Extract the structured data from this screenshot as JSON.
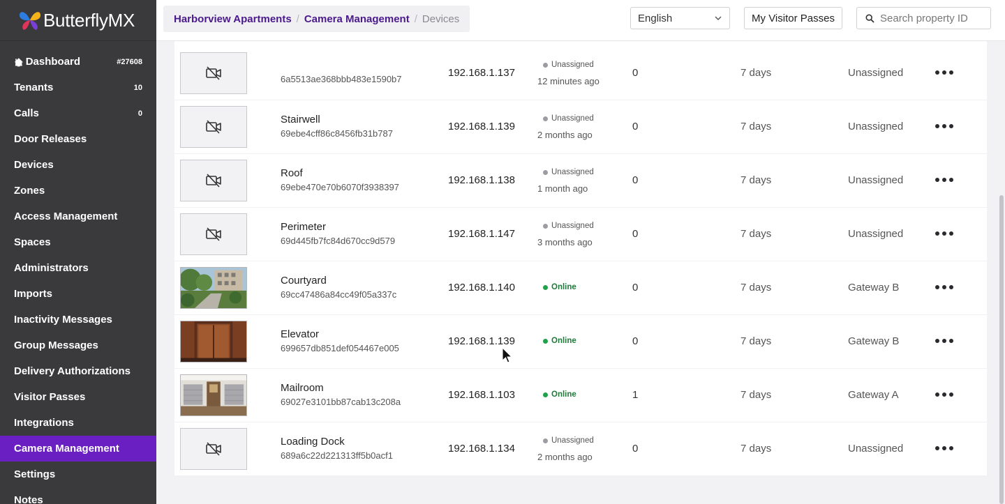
{
  "brand": {
    "name": "ButterflyMX"
  },
  "sidebar": {
    "items": [
      {
        "label": "Dashboard",
        "badge": "#27608",
        "active": false
      },
      {
        "label": "Tenants",
        "badge": "10",
        "active": false
      },
      {
        "label": "Calls",
        "badge": "0",
        "active": false
      },
      {
        "label": "Door Releases",
        "badge": "",
        "active": false
      },
      {
        "label": "Devices",
        "badge": "",
        "active": false
      },
      {
        "label": "Zones",
        "badge": "",
        "active": false
      },
      {
        "label": "Access Management",
        "badge": "",
        "active": false
      },
      {
        "label": "Spaces",
        "badge": "",
        "active": false
      },
      {
        "label": "Administrators",
        "badge": "",
        "active": false
      },
      {
        "label": "Imports",
        "badge": "",
        "active": false
      },
      {
        "label": "Inactivity Messages",
        "badge": "",
        "active": false
      },
      {
        "label": "Group Messages",
        "badge": "",
        "active": false
      },
      {
        "label": "Delivery Authorizations",
        "badge": "",
        "active": false
      },
      {
        "label": "Visitor Passes",
        "badge": "",
        "active": false
      },
      {
        "label": "Integrations",
        "badge": "",
        "active": false
      },
      {
        "label": "Camera Management",
        "badge": "",
        "active": true
      },
      {
        "label": "Settings",
        "badge": "",
        "active": false
      },
      {
        "label": "Notes",
        "badge": "",
        "active": false
      }
    ]
  },
  "breadcrumb": {
    "items": [
      "Harborview Apartments",
      "Camera Management"
    ],
    "current": "Devices",
    "separator": "/"
  },
  "header": {
    "language": "English",
    "visitor_passes_label": "My Visitor Passes",
    "search_placeholder": "Search property ID"
  },
  "cameras": [
    {
      "name": "",
      "id": "6a5513ae368bbb483e1590b7",
      "ip": "192.168.1.137",
      "status": "Unassigned",
      "online": false,
      "ago": "12 minutes ago",
      "count": "0",
      "retention": "7 days",
      "gateway": "Unassigned",
      "thumb": "none"
    },
    {
      "name": "Stairwell",
      "id": "69ebe4cff86c8456fb31b787",
      "ip": "192.168.1.139",
      "status": "Unassigned",
      "online": false,
      "ago": "2 months ago",
      "count": "0",
      "retention": "7 days",
      "gateway": "Unassigned",
      "thumb": "none"
    },
    {
      "name": "Roof",
      "id": "69ebe470e70b6070f3938397",
      "ip": "192.168.1.138",
      "status": "Unassigned",
      "online": false,
      "ago": "1 month ago",
      "count": "0",
      "retention": "7 days",
      "gateway": "Unassigned",
      "thumb": "none"
    },
    {
      "name": "Perimeter",
      "id": "69d445fb7fc84d670cc9d579",
      "ip": "192.168.1.147",
      "status": "Unassigned",
      "online": false,
      "ago": "3 months ago",
      "count": "0",
      "retention": "7 days",
      "gateway": "Unassigned",
      "thumb": "none"
    },
    {
      "name": "Courtyard",
      "id": "69cc47486a84cc49f05a337c",
      "ip": "192.168.1.140",
      "status": "Online",
      "online": true,
      "ago": "",
      "count": "0",
      "retention": "7 days",
      "gateway": "Gateway B",
      "thumb": "courtyard"
    },
    {
      "name": "Elevator",
      "id": "699657db851def054467e005",
      "ip": "192.168.1.139",
      "status": "Online",
      "online": true,
      "ago": "",
      "count": "0",
      "retention": "7 days",
      "gateway": "Gateway B",
      "thumb": "elevator"
    },
    {
      "name": "Mailroom",
      "id": "69027e3101bb87cab13c208a",
      "ip": "192.168.1.103",
      "status": "Online",
      "online": true,
      "ago": "",
      "count": "1",
      "retention": "7 days",
      "gateway": "Gateway A",
      "thumb": "mailroom"
    },
    {
      "name": "Loading Dock",
      "id": "689a6c22d221313ff5b0acf1",
      "ip": "192.168.1.134",
      "status": "Unassigned",
      "online": false,
      "ago": "2 months ago",
      "count": "0",
      "retention": "7 days",
      "gateway": "Unassigned",
      "thumb": "none"
    }
  ],
  "colors": {
    "sidebar_bg": "#3a3a3d",
    "active_nav": "#6a1fc2",
    "breadcrumb_link": "#4a1a8c",
    "online_dot": "#22a14a",
    "offline_dot": "#9c9ca2"
  },
  "icons": {
    "dashboard": "home-icon",
    "camera_off": "camera-off-icon",
    "more": "more-horizontal-icon",
    "search": "search-icon",
    "dropdown": "chevron-down-icon"
  }
}
